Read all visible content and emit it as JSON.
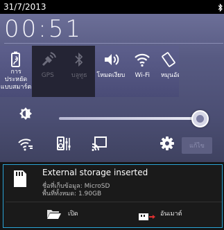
{
  "status_bar": {
    "date": "31/7/2013",
    "icons": [
      "bluetooth-icon"
    ]
  },
  "clock": {
    "time": "00:51"
  },
  "tiles": [
    {
      "label": "การประหยัด แบบสมาร์ต",
      "icon": "battery-saver-icon",
      "state": "on"
    },
    {
      "label": "GPS",
      "icon": "gps-icon",
      "state": "off"
    },
    {
      "label": "บลูทูธ",
      "icon": "bluetooth-icon",
      "state": "off"
    },
    {
      "label": "โหมดเงียบ",
      "icon": "sound-icon",
      "state": "on"
    },
    {
      "label": "Wi-Fi",
      "icon": "wifi-icon",
      "state": "on"
    },
    {
      "label": "หมุนอัต",
      "icon": "rotate-icon",
      "state": "on"
    }
  ],
  "brightness": {
    "level": 0.98,
    "icon": "brightness-icon"
  },
  "quick_icons": [
    "wifi-settings-icon",
    "audio-settings-icon",
    "cast-icon",
    "settings-icon"
  ],
  "edit_button": {
    "label": "แก้ไข"
  },
  "notification": {
    "icon": "sd-card-icon",
    "title": "External storage inserted",
    "line1": "ชื่อที่เก็บข้อมูล: MicroSD",
    "line2": "พื้นที่ทั้งหมด: 1.90GB",
    "actions": [
      {
        "label": "เปิด",
        "icon": "folder-open-icon"
      },
      {
        "label": "อันเมาต์",
        "icon": "unmount-icon"
      }
    ]
  },
  "colors": {
    "accent": "#2aa3d6",
    "panel": "#575a82",
    "tile_off": "#242434"
  }
}
